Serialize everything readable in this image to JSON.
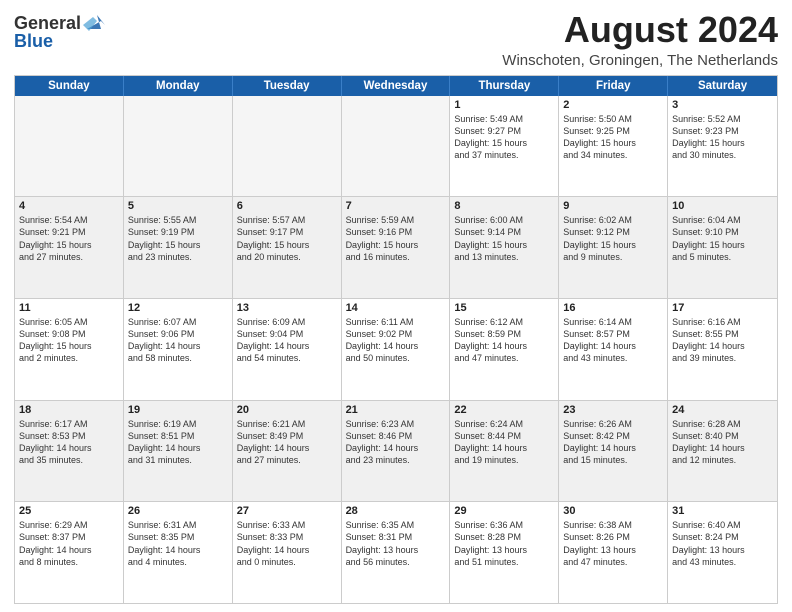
{
  "header": {
    "logo_general": "General",
    "logo_blue": "Blue",
    "month_title": "August 2024",
    "location": "Winschoten, Groningen, The Netherlands"
  },
  "weekdays": [
    "Sunday",
    "Monday",
    "Tuesday",
    "Wednesday",
    "Thursday",
    "Friday",
    "Saturday"
  ],
  "rows": [
    [
      {
        "day": "",
        "info": "",
        "empty": true
      },
      {
        "day": "",
        "info": "",
        "empty": true
      },
      {
        "day": "",
        "info": "",
        "empty": true
      },
      {
        "day": "",
        "info": "",
        "empty": true
      },
      {
        "day": "1",
        "info": "Sunrise: 5:49 AM\nSunset: 9:27 PM\nDaylight: 15 hours\nand 37 minutes."
      },
      {
        "day": "2",
        "info": "Sunrise: 5:50 AM\nSunset: 9:25 PM\nDaylight: 15 hours\nand 34 minutes."
      },
      {
        "day": "3",
        "info": "Sunrise: 5:52 AM\nSunset: 9:23 PM\nDaylight: 15 hours\nand 30 minutes."
      }
    ],
    [
      {
        "day": "4",
        "info": "Sunrise: 5:54 AM\nSunset: 9:21 PM\nDaylight: 15 hours\nand 27 minutes."
      },
      {
        "day": "5",
        "info": "Sunrise: 5:55 AM\nSunset: 9:19 PM\nDaylight: 15 hours\nand 23 minutes."
      },
      {
        "day": "6",
        "info": "Sunrise: 5:57 AM\nSunset: 9:17 PM\nDaylight: 15 hours\nand 20 minutes."
      },
      {
        "day": "7",
        "info": "Sunrise: 5:59 AM\nSunset: 9:16 PM\nDaylight: 15 hours\nand 16 minutes."
      },
      {
        "day": "8",
        "info": "Sunrise: 6:00 AM\nSunset: 9:14 PM\nDaylight: 15 hours\nand 13 minutes."
      },
      {
        "day": "9",
        "info": "Sunrise: 6:02 AM\nSunset: 9:12 PM\nDaylight: 15 hours\nand 9 minutes."
      },
      {
        "day": "10",
        "info": "Sunrise: 6:04 AM\nSunset: 9:10 PM\nDaylight: 15 hours\nand 5 minutes."
      }
    ],
    [
      {
        "day": "11",
        "info": "Sunrise: 6:05 AM\nSunset: 9:08 PM\nDaylight: 15 hours\nand 2 minutes."
      },
      {
        "day": "12",
        "info": "Sunrise: 6:07 AM\nSunset: 9:06 PM\nDaylight: 14 hours\nand 58 minutes."
      },
      {
        "day": "13",
        "info": "Sunrise: 6:09 AM\nSunset: 9:04 PM\nDaylight: 14 hours\nand 54 minutes."
      },
      {
        "day": "14",
        "info": "Sunrise: 6:11 AM\nSunset: 9:02 PM\nDaylight: 14 hours\nand 50 minutes."
      },
      {
        "day": "15",
        "info": "Sunrise: 6:12 AM\nSunset: 8:59 PM\nDaylight: 14 hours\nand 47 minutes."
      },
      {
        "day": "16",
        "info": "Sunrise: 6:14 AM\nSunset: 8:57 PM\nDaylight: 14 hours\nand 43 minutes."
      },
      {
        "day": "17",
        "info": "Sunrise: 6:16 AM\nSunset: 8:55 PM\nDaylight: 14 hours\nand 39 minutes."
      }
    ],
    [
      {
        "day": "18",
        "info": "Sunrise: 6:17 AM\nSunset: 8:53 PM\nDaylight: 14 hours\nand 35 minutes."
      },
      {
        "day": "19",
        "info": "Sunrise: 6:19 AM\nSunset: 8:51 PM\nDaylight: 14 hours\nand 31 minutes."
      },
      {
        "day": "20",
        "info": "Sunrise: 6:21 AM\nSunset: 8:49 PM\nDaylight: 14 hours\nand 27 minutes."
      },
      {
        "day": "21",
        "info": "Sunrise: 6:23 AM\nSunset: 8:46 PM\nDaylight: 14 hours\nand 23 minutes."
      },
      {
        "day": "22",
        "info": "Sunrise: 6:24 AM\nSunset: 8:44 PM\nDaylight: 14 hours\nand 19 minutes."
      },
      {
        "day": "23",
        "info": "Sunrise: 6:26 AM\nSunset: 8:42 PM\nDaylight: 14 hours\nand 15 minutes."
      },
      {
        "day": "24",
        "info": "Sunrise: 6:28 AM\nSunset: 8:40 PM\nDaylight: 14 hours\nand 12 minutes."
      }
    ],
    [
      {
        "day": "25",
        "info": "Sunrise: 6:29 AM\nSunset: 8:37 PM\nDaylight: 14 hours\nand 8 minutes."
      },
      {
        "day": "26",
        "info": "Sunrise: 6:31 AM\nSunset: 8:35 PM\nDaylight: 14 hours\nand 4 minutes."
      },
      {
        "day": "27",
        "info": "Sunrise: 6:33 AM\nSunset: 8:33 PM\nDaylight: 14 hours\nand 0 minutes."
      },
      {
        "day": "28",
        "info": "Sunrise: 6:35 AM\nSunset: 8:31 PM\nDaylight: 13 hours\nand 56 minutes."
      },
      {
        "day": "29",
        "info": "Sunrise: 6:36 AM\nSunset: 8:28 PM\nDaylight: 13 hours\nand 51 minutes."
      },
      {
        "day": "30",
        "info": "Sunrise: 6:38 AM\nSunset: 8:26 PM\nDaylight: 13 hours\nand 47 minutes."
      },
      {
        "day": "31",
        "info": "Sunrise: 6:40 AM\nSunset: 8:24 PM\nDaylight: 13 hours\nand 43 minutes."
      }
    ]
  ]
}
